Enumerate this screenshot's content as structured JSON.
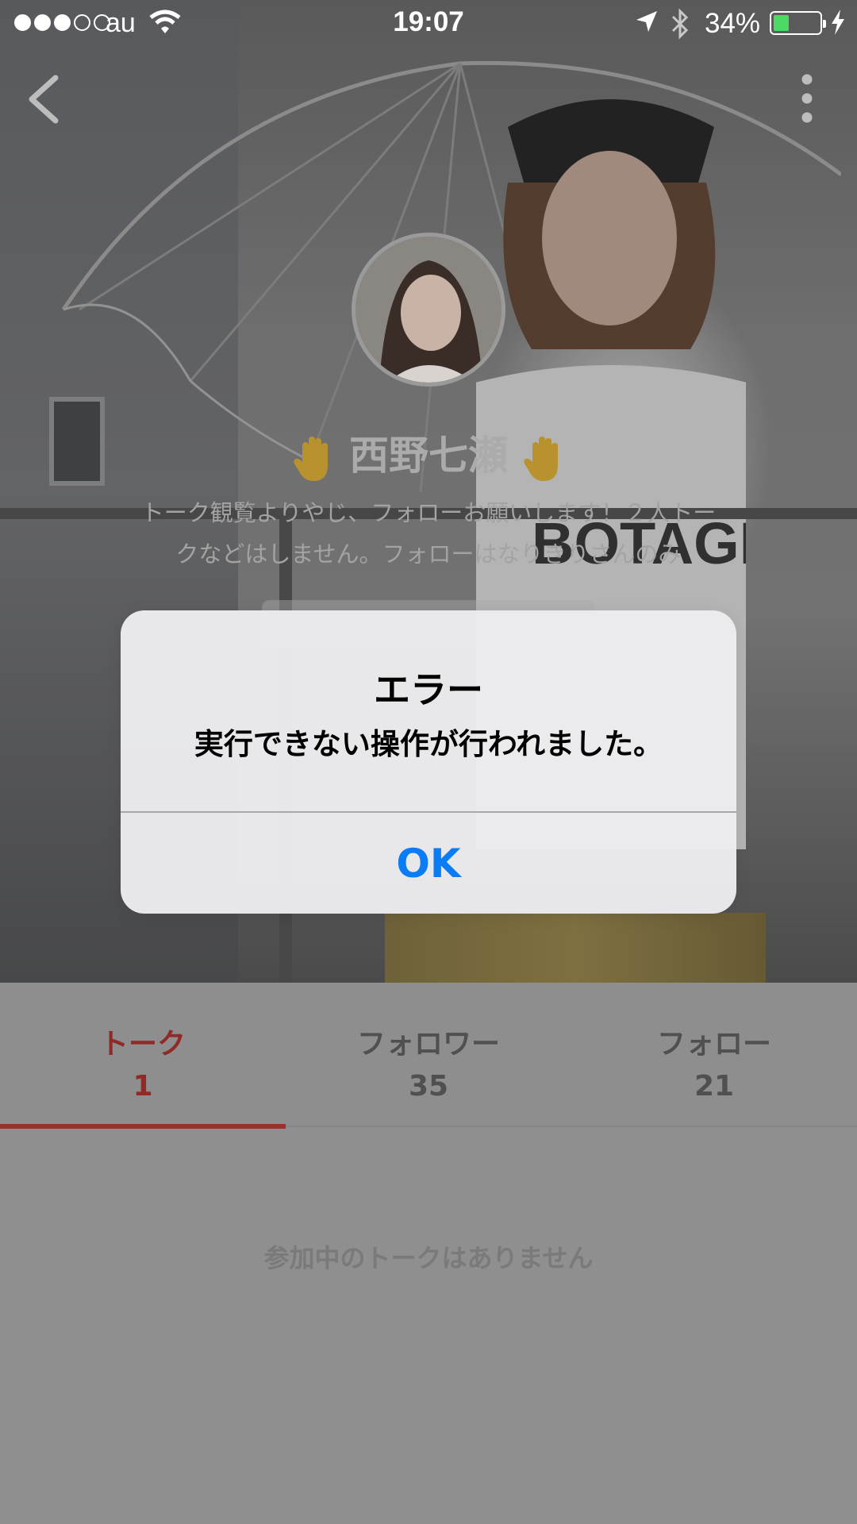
{
  "status_bar": {
    "carrier": "au",
    "time": "19:07",
    "battery_percent": "34%",
    "battery_level": 0.34,
    "signal_bars_filled": 3,
    "signal_bars_total": 5
  },
  "profile": {
    "name": "西野七瀬",
    "bio_line1": "トーク観覧よりやじ、フォローお願いします！２人トー",
    "bio_line2": "クなどはしません。フォローはなりきりさんのみ"
  },
  "tabs": [
    {
      "label": "トーク",
      "count": "1",
      "active": true
    },
    {
      "label": "フォロワー",
      "count": "35",
      "active": false
    },
    {
      "label": "フォロー",
      "count": "21",
      "active": false
    }
  ],
  "content": {
    "empty_message": "参加中のトークはありません"
  },
  "alert": {
    "title": "エラー",
    "message": "実行できない操作が行われました。",
    "ok_label": "OK"
  },
  "colors": {
    "accent_red": "#9a2f2c",
    "ios_blue": "#0a7cf5",
    "battery_green": "#4cd964"
  },
  "icons": [
    "back-chevron-icon",
    "more-vertical-icon",
    "wifi-icon",
    "location-arrow-icon",
    "bluetooth-icon",
    "battery-icon",
    "charging-bolt-icon",
    "raised-hand-icon"
  ]
}
